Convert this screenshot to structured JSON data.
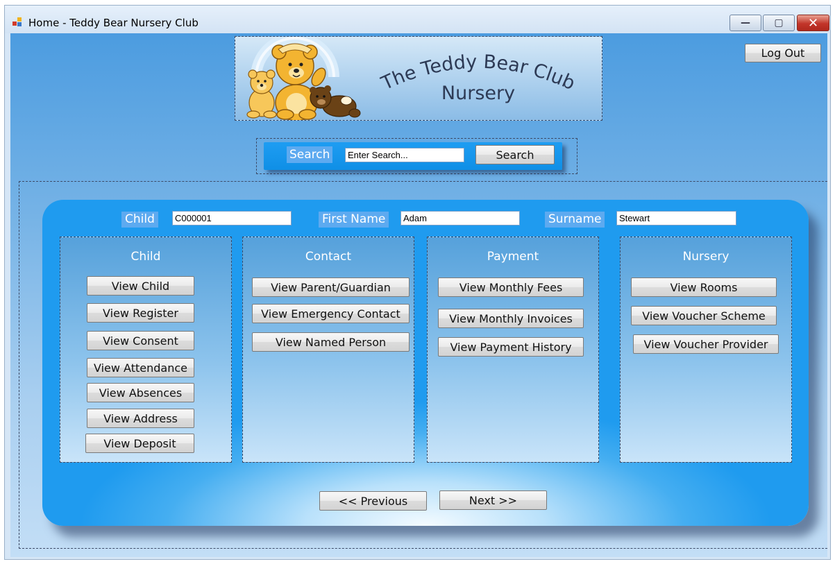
{
  "window": {
    "title": "Home - Teddy Bear Nursery Club",
    "controls": {
      "minimize": "—",
      "maximize": "▢",
      "close": "✕"
    }
  },
  "header": {
    "logo_line1": "The Teddy Bear Club",
    "logo_line2": "Nursery",
    "logout_label": "Log Out"
  },
  "search": {
    "label": "Search",
    "input_value": "Enter Search...",
    "button_label": "Search"
  },
  "record": {
    "child_label": "Child",
    "child_id": "C000001",
    "first_name_label": "First Name",
    "first_name": "Adam",
    "surname_label": "Surname",
    "surname": "Stewart"
  },
  "groups": {
    "child": {
      "title": "Child",
      "buttons": [
        "View Child",
        "View Register",
        "View Consent",
        "View Attendance",
        "View Absences",
        "View Address",
        "View Deposit"
      ]
    },
    "contact": {
      "title": "Contact",
      "buttons": [
        "View Parent/Guardian",
        "View Emergency Contact",
        "View Named Person"
      ]
    },
    "payment": {
      "title": "Payment",
      "buttons": [
        "View Monthly Fees",
        "View Monthly Invoices",
        "View Payment History"
      ]
    },
    "nursery": {
      "title": "Nursery",
      "buttons": [
        "View Rooms",
        "View Voucher Scheme",
        "View Voucher Provider"
      ]
    }
  },
  "navigation": {
    "previous_label": "<< Previous",
    "next_label": "Next >>"
  },
  "colors": {
    "panel_blue": "#1f9bef",
    "label_blue": "#5daaf0",
    "close_red": "#c2352a"
  }
}
